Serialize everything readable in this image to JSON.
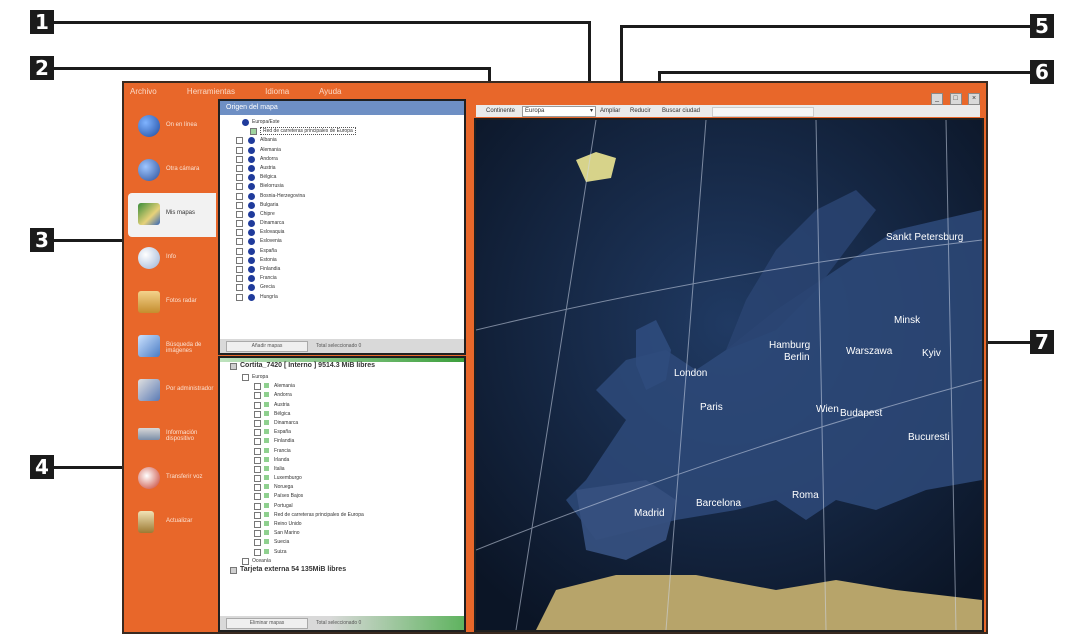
{
  "callouts": [
    "1",
    "2",
    "3",
    "4",
    "5",
    "6",
    "7"
  ],
  "menu": [
    "Archivo",
    "Herramientas",
    "Idioma",
    "Ayuda"
  ],
  "window_buttons": [
    "_",
    "□",
    "×"
  ],
  "sidebar": {
    "items": [
      {
        "label": "On en línea",
        "icon": "globe-icon"
      },
      {
        "label": "Otra cámara",
        "icon": "globe-camera-icon"
      },
      {
        "label": "Mis mapas",
        "icon": "maps-icon"
      },
      {
        "label": "Info",
        "icon": "info-icon"
      },
      {
        "label": "Fotos radar",
        "icon": "radar-folder-icon"
      },
      {
        "label": "Búsqueda de imágenes",
        "icon": "image-search-icon"
      },
      {
        "label": "Por administrador",
        "icon": "admin-icon"
      },
      {
        "label": "Información dispositivo",
        "icon": "device-info-icon"
      },
      {
        "label": "Transferir voz",
        "icon": "voice-transfer-icon"
      },
      {
        "label": "Actualizar",
        "icon": "update-icon"
      }
    ],
    "active_index": 2
  },
  "source_panel": {
    "title": "Origen del mapa",
    "root": "Europa/Este",
    "selected": "Red de carreteras principales de Europa",
    "items": [
      "Albania",
      "Alemania",
      "Andorra",
      "Austria",
      "Bélgica",
      "Bielorrusia",
      "Bosnia-Herzegovina",
      "Bulgaria",
      "Chipre",
      "Dinamarca",
      "Eslovaquia",
      "Eslovenia",
      "España",
      "Estonia",
      "Finlandia",
      "Francia",
      "Grecia",
      "Hungría"
    ],
    "add_button": "Añadir mapas",
    "note": "Total seleccionado 0"
  },
  "device_panel": {
    "drive": "Cortita_7420 [ Interno ] 9514.3 MiB libres",
    "group": "Europa",
    "items": [
      "Alemania",
      "Andorra",
      "Austria",
      "Bélgica",
      "Dinamarca",
      "España",
      "Finlandia",
      "Francia",
      "Irlanda",
      "Italia",
      "Luxemburgo",
      "Noruega",
      "Países Bajos",
      "Portugal",
      "Red de carreteras principales de Europa",
      "Reino Unido",
      "San Marino",
      "Suecia",
      "Suiza"
    ],
    "other": "Oceanía",
    "card": "Tarjeta externa 54 135MiB libres",
    "remove_button": "Eliminar mapas",
    "note": "Total seleccionado 0"
  },
  "toolbar": {
    "continent_label": "Continente",
    "continent_value": "Europa",
    "zoom_in": "Ampliar",
    "zoom_out": "Reducir",
    "find": "Buscar ciudad"
  },
  "map_cities": [
    "Sankt Petersburg",
    "Minsk",
    "Warszawa",
    "Kyiv",
    "Hamburg",
    "Berlin",
    "London",
    "Paris",
    "Wien",
    "Budapest",
    "Bucuresti",
    "Madrid",
    "Barcelona",
    "Roma"
  ]
}
